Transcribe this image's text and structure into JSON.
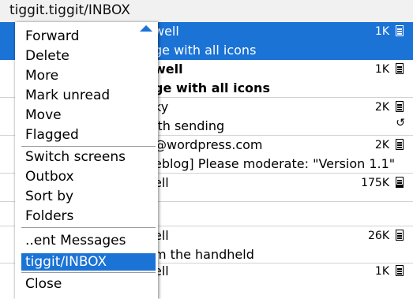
{
  "window": {
    "title": "tiggit.tiggit/INBOX"
  },
  "messages": [
    {
      "sender": "well",
      "size": "1K",
      "subject": "ge with all icons",
      "icon": "envelope-icon",
      "selected": true,
      "unread": false,
      "pending": false
    },
    {
      "sender": "well",
      "size": "1K",
      "subject": "ge with all icons",
      "icon": "envelope-icon",
      "selected": false,
      "unread": true,
      "pending": false
    },
    {
      "sender": "ky",
      "size": "2K",
      "subject": "ith sending",
      "icon": "envelope-icon",
      "selected": false,
      "unread": false,
      "pending": true
    },
    {
      "sender": "@wordpress.com",
      "size": "2K",
      "subject": "eblog] Please moderate: \"Version 1.1\"",
      "icon": "envelope-icon",
      "selected": false,
      "unread": false,
      "pending": false
    },
    {
      "sender": "ell",
      "size": "175K",
      "subject": "",
      "icon": "envelope-open-icon",
      "selected": false,
      "unread": false,
      "pending": false
    },
    {
      "sender": "ell",
      "size": "26K",
      "subject": "m the handheld",
      "icon": "envelope-icon",
      "selected": false,
      "unread": false,
      "pending": false
    },
    {
      "sender": "ell",
      "size": "1K",
      "subject": "",
      "icon": "envelope-icon",
      "selected": false,
      "unread": false,
      "pending": false
    }
  ],
  "menu": {
    "items": [
      "Forward",
      "Delete",
      "More",
      "Mark unread",
      "Move",
      "Flagged",
      "Switch screens",
      "Outbox",
      "Sort by",
      "Folders",
      "..ent Messages",
      "tiggit/INBOX",
      "Close"
    ],
    "active_item": "tiggit/INBOX"
  },
  "colors": {
    "selection": "#1b73d6",
    "title_bar": "#f1f1f1"
  }
}
